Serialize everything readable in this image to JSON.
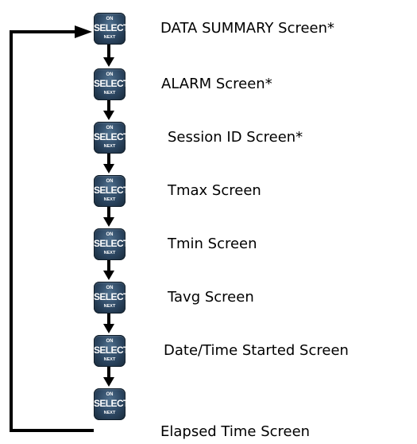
{
  "button": {
    "top": "ON",
    "main": "SELECT",
    "bottom": "NEXT"
  },
  "screens": [
    "DATA SUMMARY Screen*",
    "ALARM Screen*",
    "Session ID Screen*",
    "Tmax Screen",
    "Tmin Screen",
    "Tavg Screen",
    "Date/Time Started Screen",
    "Elapsed Time Screen"
  ],
  "colors": {
    "arrow": "#000000",
    "button": "#2b4560",
    "button_text": "#ffffff"
  }
}
